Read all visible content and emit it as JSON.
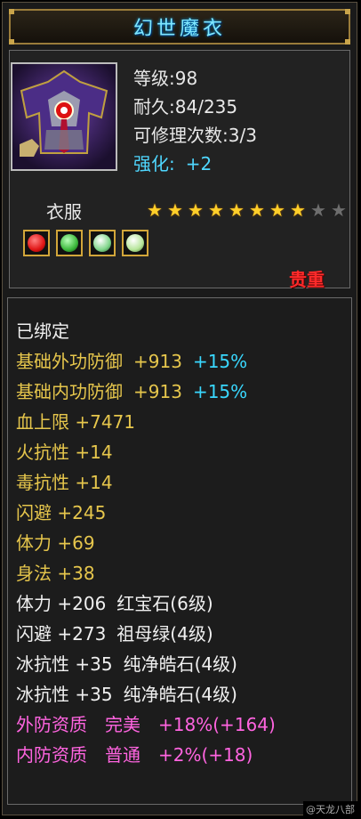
{
  "item": {
    "name": "幻世魔衣",
    "level_label": "等级:",
    "level": "98",
    "durability_label": "耐久:",
    "durability": "84/235",
    "repair_label": "可修理次数:",
    "repair": "3/3",
    "enhance_label": "强化:",
    "enhance": "+2",
    "type": "衣服",
    "stars_total": 10,
    "stars_filled": 8,
    "precious_tag": "贵重"
  },
  "gems": [
    {
      "icon": "red-gem-icon",
      "color": "#e01515"
    },
    {
      "icon": "green-gem-icon",
      "color": "#3cb83c"
    },
    {
      "icon": "white-green-gem-icon",
      "color": "#7fd58a"
    },
    {
      "icon": "white-green-gem-icon",
      "color": "#b6e59a"
    }
  ],
  "stats": {
    "bound": "已绑定",
    "base_outer": {
      "label": "基础外功防御",
      "value": "+913",
      "bonus": "+15%"
    },
    "base_inner": {
      "label": "基础内功防御",
      "value": "+913",
      "bonus": "+15%"
    },
    "hp": "血上限 +7471",
    "fire_res": "火抗性 +14",
    "poison_res": "毒抗性 +14",
    "dodge": "闪避 +245",
    "stamina": "体力 +69",
    "agility": "身法 +38",
    "gem1": {
      "stat": "体力 +206",
      "gem": "红宝石(6级)"
    },
    "gem2": {
      "stat": "闪避 +273",
      "gem": "祖母绿(4级)"
    },
    "gem3": {
      "stat": "冰抗性 +35",
      "gem": "纯净皓石(4级)"
    },
    "gem4": {
      "stat": "冰抗性 +35",
      "gem": "纯净皓石(4级)"
    },
    "outer_quality": {
      "label": "外防资质",
      "grade": "完美",
      "value": "+18%(+164)"
    },
    "inner_quality": {
      "label": "内防资质",
      "grade": "普通",
      "value": "+2%(+18)"
    }
  },
  "watermark": "@天龙八部"
}
